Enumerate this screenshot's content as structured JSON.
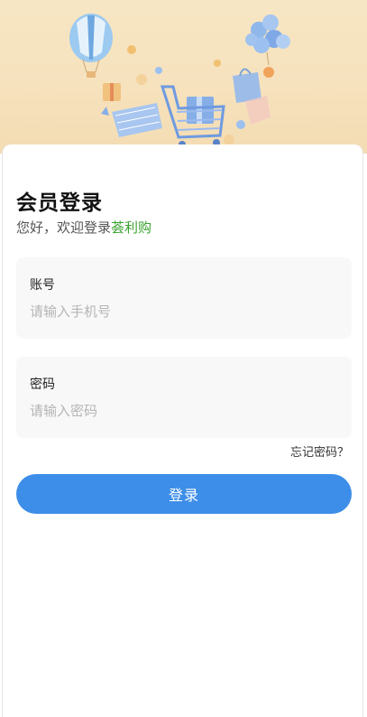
{
  "hero": {
    "illustration": "shopping-cart-illustration",
    "colors": {
      "background": "#f6e2bd",
      "accent": "#8fb7ea"
    }
  },
  "login": {
    "title": "会员登录",
    "greeting": "您好，欢迎登录",
    "brand": "荟利购",
    "username": {
      "label": "账号",
      "placeholder": "请输入手机号",
      "value": ""
    },
    "password": {
      "label": "密码",
      "placeholder": "请输入密码",
      "value": ""
    },
    "forgot": "忘记密码？",
    "submit": "登录"
  },
  "colors": {
    "primary": "#3d8ee8",
    "brand": "#3aa12f",
    "field_bg": "#f8f8f8"
  }
}
